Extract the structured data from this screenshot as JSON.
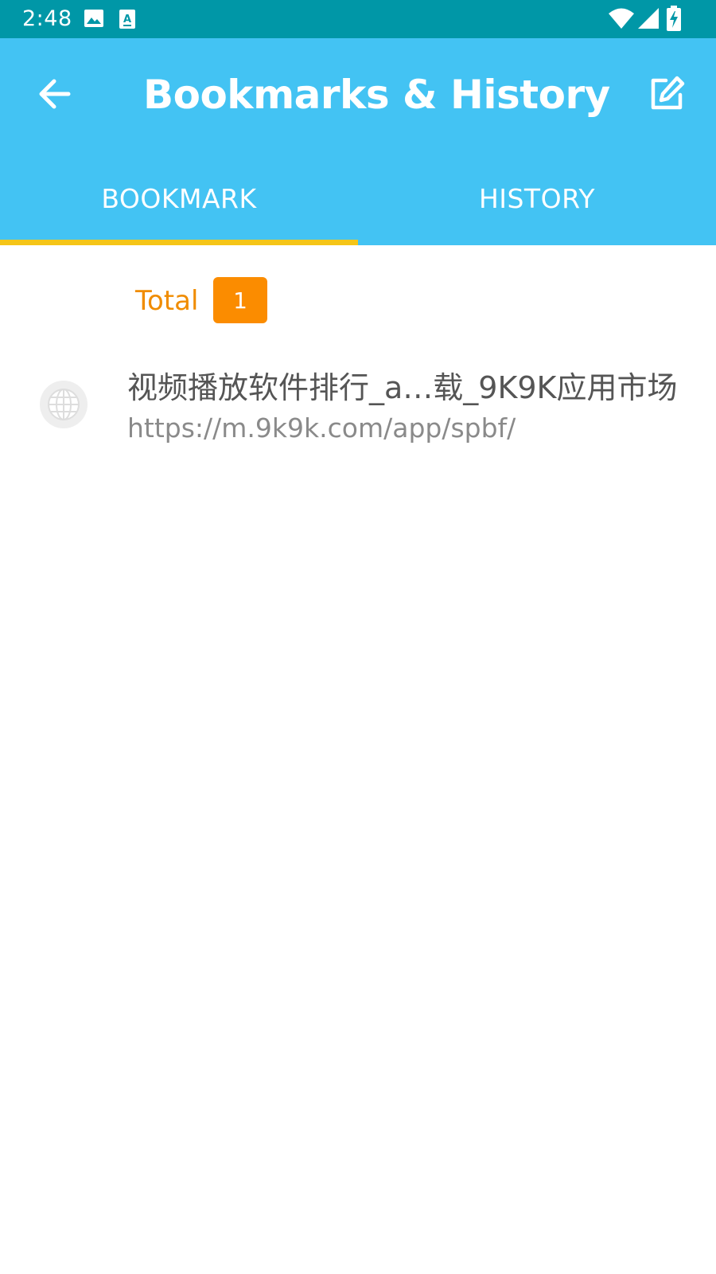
{
  "status_bar": {
    "time": "2:48",
    "icons": [
      "image-icon",
      "font-icon",
      "wifi-icon",
      "signal-icon",
      "battery-charging-icon"
    ]
  },
  "app_bar": {
    "title": "Bookmarks & History",
    "back_icon": "arrow-back-icon",
    "edit_icon": "edit-icon"
  },
  "tabs": [
    {
      "label": "BOOKMARK",
      "selected": true
    },
    {
      "label": "HISTORY",
      "selected": false
    }
  ],
  "total": {
    "label": "Total",
    "count": "1"
  },
  "bookmarks": [
    {
      "title": "视频播放软件排行_a…载_9K9K应用市场",
      "url": "https://m.9k9k.com/app/spbf/",
      "icon": "globe-icon"
    }
  ],
  "colors": {
    "status_bar": "#0097a7",
    "app_bar": "#43c3f3",
    "tab_indicator": "#f5c518",
    "total_text": "#f08c00",
    "badge": "#fb8c00"
  }
}
